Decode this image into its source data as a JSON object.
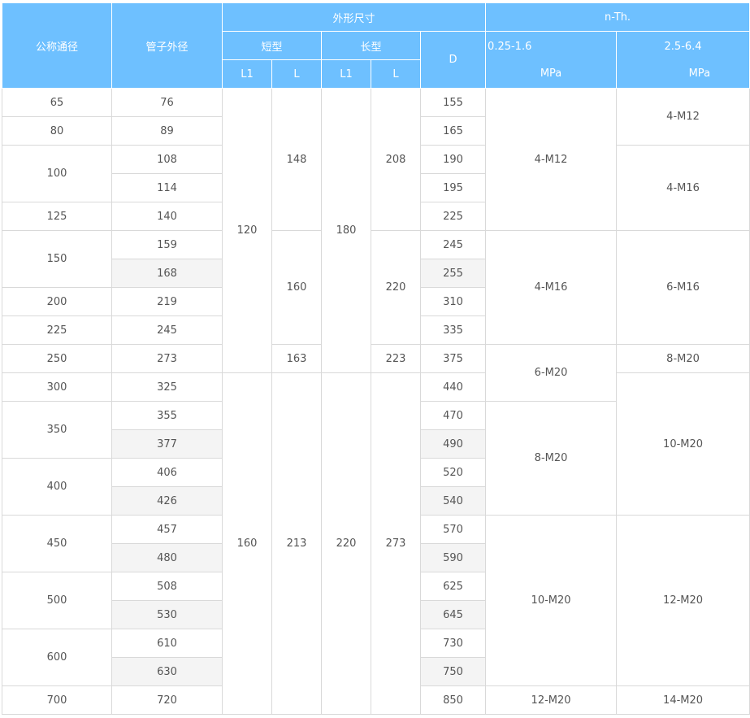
{
  "header": {
    "nominal": "公称通径",
    "pipe_od": "管子外径",
    "dims": "外形尺寸",
    "nth": "n-Th.",
    "short": "短型",
    "long": "长型",
    "d": "D",
    "l1_short": "L1",
    "l_short": "L",
    "l1_long": "L1",
    "l_long": "L",
    "p_low": "0.25-1.6",
    "p_low_unit": "MPa",
    "p_high": "2.5-6.4",
    "p_high_unit": "MPa"
  },
  "rows": {
    "dn": [
      "65",
      "80",
      "100",
      "125",
      "150",
      "200",
      "225",
      "250",
      "300",
      "350",
      "400",
      "450",
      "500",
      "600",
      "700"
    ],
    "od": [
      "76",
      "89",
      "108",
      "114",
      "140",
      "159",
      "168",
      "219",
      "245",
      "273",
      "325",
      "355",
      "377",
      "406",
      "426",
      "457",
      "480",
      "508",
      "530",
      "610",
      "630",
      "720"
    ],
    "d": [
      "155",
      "165",
      "190",
      "195",
      "225",
      "245",
      "255",
      "310",
      "335",
      "375",
      "440",
      "470",
      "490",
      "520",
      "540",
      "570",
      "590",
      "625",
      "645",
      "730",
      "750",
      "850"
    ],
    "l1_short": [
      "120",
      "160"
    ],
    "l_short": [
      "148",
      "160",
      "163",
      "213"
    ],
    "l1_long": [
      "180",
      "220"
    ],
    "l_long": [
      "208",
      "220",
      "223",
      "273"
    ],
    "bolts_low": [
      "4-M12",
      "4-M16",
      "6-M20",
      "8-M20",
      "10-M20",
      "12-M20"
    ],
    "bolts_high": [
      "4-M12",
      "4-M16",
      "6-M16",
      "8-M20",
      "10-M20",
      "12-M20",
      "14-M20"
    ]
  }
}
